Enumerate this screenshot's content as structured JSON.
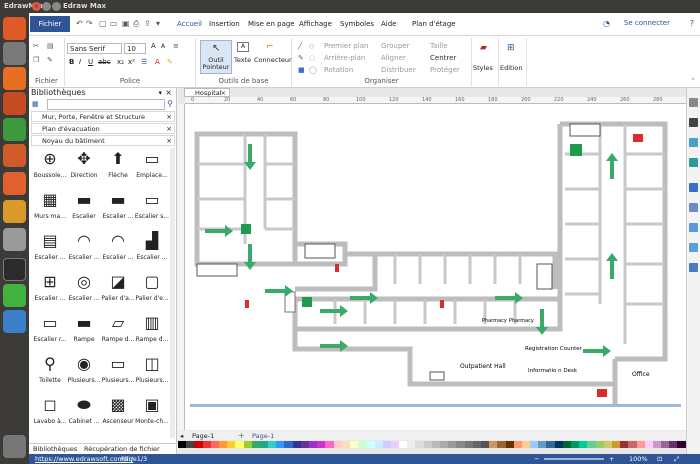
{
  "window": {
    "title": "EdrawMax",
    "app_title": "Edraw Max"
  },
  "menu": {
    "file": "Fichier",
    "items": [
      "Accueil",
      "Insertion",
      "Mise en page",
      "Affichage",
      "Symboles",
      "Aide",
      "Plan d'étage"
    ],
    "connect": "Se connecter"
  },
  "ribbon": {
    "font_name": "Sans Serif",
    "font_size": "10",
    "groups": {
      "file": "Fichier",
      "font": "Police",
      "tools": "Outils de base",
      "arrange": "Organiser"
    },
    "tool_pointer": "Outil Pointeur",
    "tool_text": "Texte",
    "tool_connector": "Connecteur",
    "arrange_items": [
      "Premier plan",
      "Arrière-plan",
      "Rotation",
      "Grouper",
      "Aligner",
      "Distribuer",
      "Taille",
      "Centrer",
      "Protéger"
    ],
    "styles": "Styles",
    "edition": "Edition"
  },
  "library": {
    "title": "Bibliothèques",
    "categories": [
      "Mur, Porte, Fenêtre et Structure",
      "Plan d'évacuation",
      "Noyau du bâtiment"
    ],
    "shapes": [
      "Boussole...",
      "Direction",
      "Flèche",
      "Emplace...",
      "Murs ma...",
      "Escalier",
      "Escalier ...",
      "Escalier s...",
      "Escalier ...",
      "Escalier ...",
      "Escalier ...",
      "Escalier ...",
      "Escalier ...",
      "Escalier ...",
      "Palier d'a...",
      "Palier d'e...",
      "Escalier r...",
      "Rampe",
      "Rampe d...",
      "Rampe d...",
      "Toilette",
      "Plusieurs...",
      "Plusieurs...",
      "Plusieurs...",
      "Lavabo à...",
      "Cabinet ...",
      "Ascenseur",
      "Monte-ch..."
    ],
    "tabs": [
      "Bibliothèques",
      "Récupération de fichier"
    ]
  },
  "document": {
    "tab": "Hospital",
    "page_tabs": [
      "Page-1",
      "Page-1"
    ],
    "ruler_numbers": [
      "0",
      "20",
      "40",
      "60",
      "80",
      "100",
      "120",
      "140",
      "160",
      "180",
      "200",
      "220",
      "240",
      "260",
      "280"
    ],
    "plan_labels": {
      "pharmacy1": "Pharmacy",
      "pharmacy2": "Pharmacy",
      "registration": "Registration Counter",
      "info": "Informatio n Desk",
      "outpatient": "Outpatient Hall",
      "office": "Office"
    }
  },
  "status": {
    "url": "https://www.edrawsoft.com/fr/",
    "page": "Page1/3",
    "zoom": "100%"
  },
  "colors": {
    "accent": "#2f5597",
    "arrow": "#3aaa6a",
    "wall": "#bdbdbd",
    "exit": "#1f9a4f",
    "fire": "#e0292a"
  }
}
